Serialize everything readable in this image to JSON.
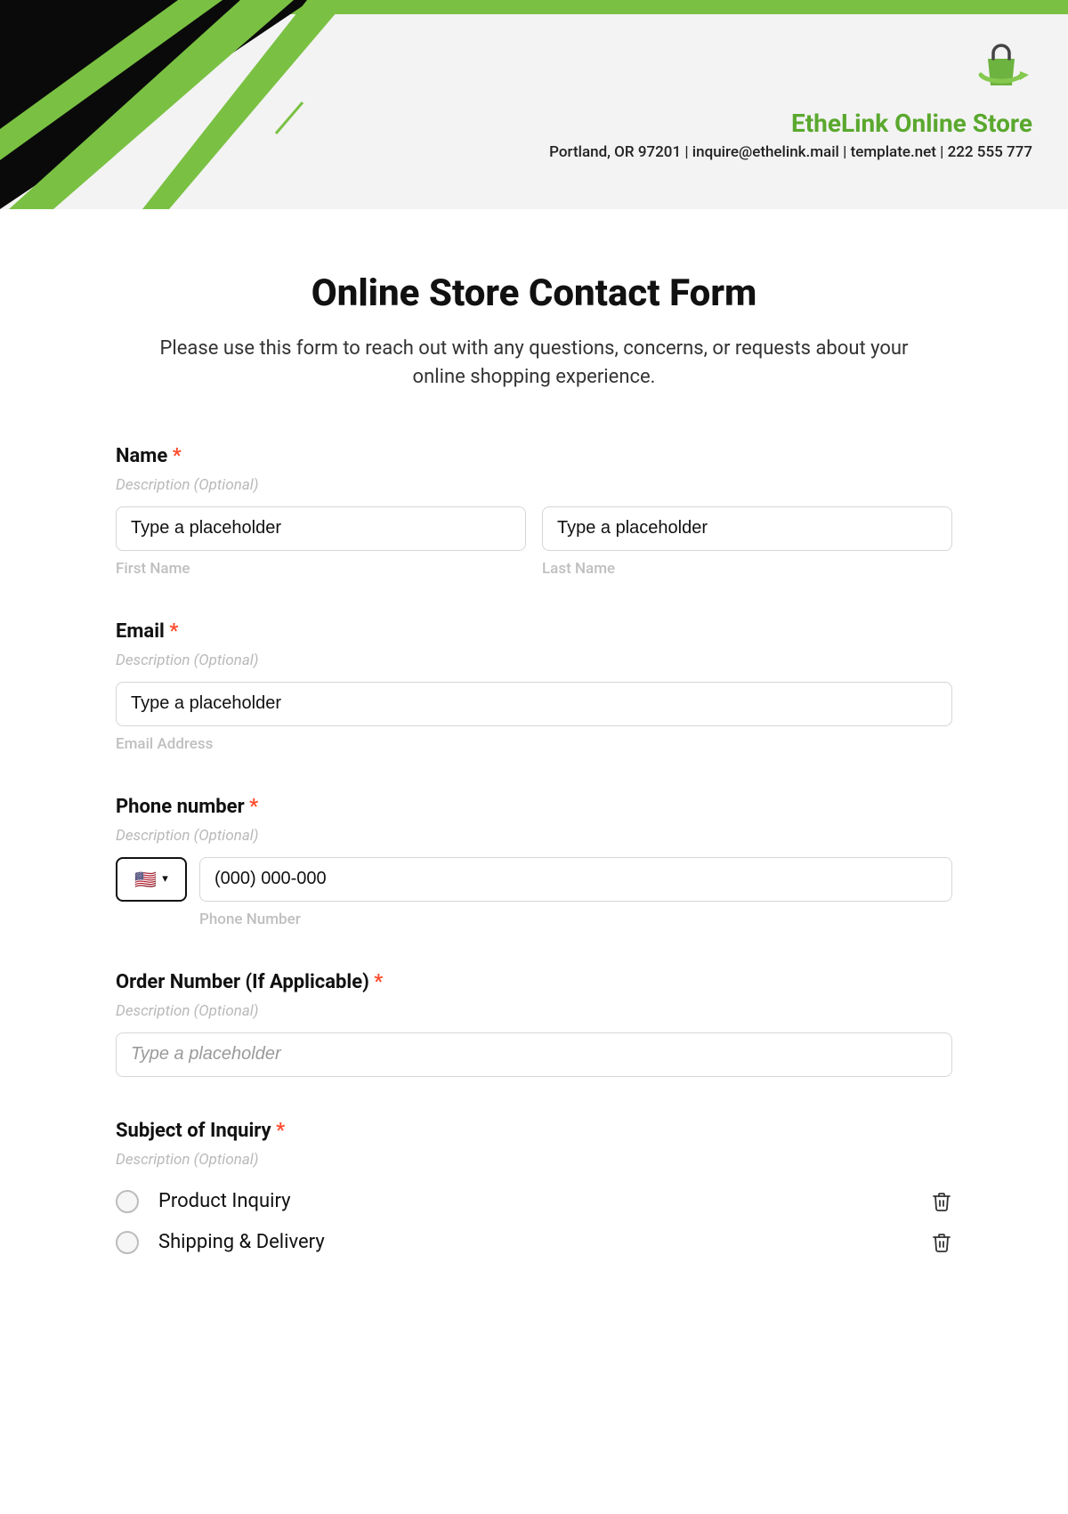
{
  "header": {
    "brand_name": "EtheLink Online Store",
    "contact_line": "Portland, OR 97201 | inquire@ethelink.mail | template.net | 222 555 777"
  },
  "form": {
    "title": "Online Store Contact Form",
    "description": "Please use this form to reach out with any questions, concerns, or requests about your online shopping experience.",
    "desc_optional": "Description (Optional)",
    "required_mark": "*",
    "fields": {
      "name": {
        "label": "Name",
        "first_placeholder": "Type a placeholder",
        "last_placeholder": "Type a placeholder",
        "first_sub": "First Name",
        "last_sub": "Last Name"
      },
      "email": {
        "label": "Email",
        "placeholder": "Type a placeholder",
        "sub": "Email Address"
      },
      "phone": {
        "label": "Phone number",
        "placeholder": "(000) 000-000",
        "sub": "Phone Number",
        "flag": "🇺🇸"
      },
      "order": {
        "label": "Order Number (If Applicable)",
        "placeholder": "Type a placeholder"
      },
      "subject": {
        "label": "Subject of Inquiry",
        "options": [
          "Product Inquiry",
          "Shipping & Delivery"
        ]
      }
    }
  }
}
